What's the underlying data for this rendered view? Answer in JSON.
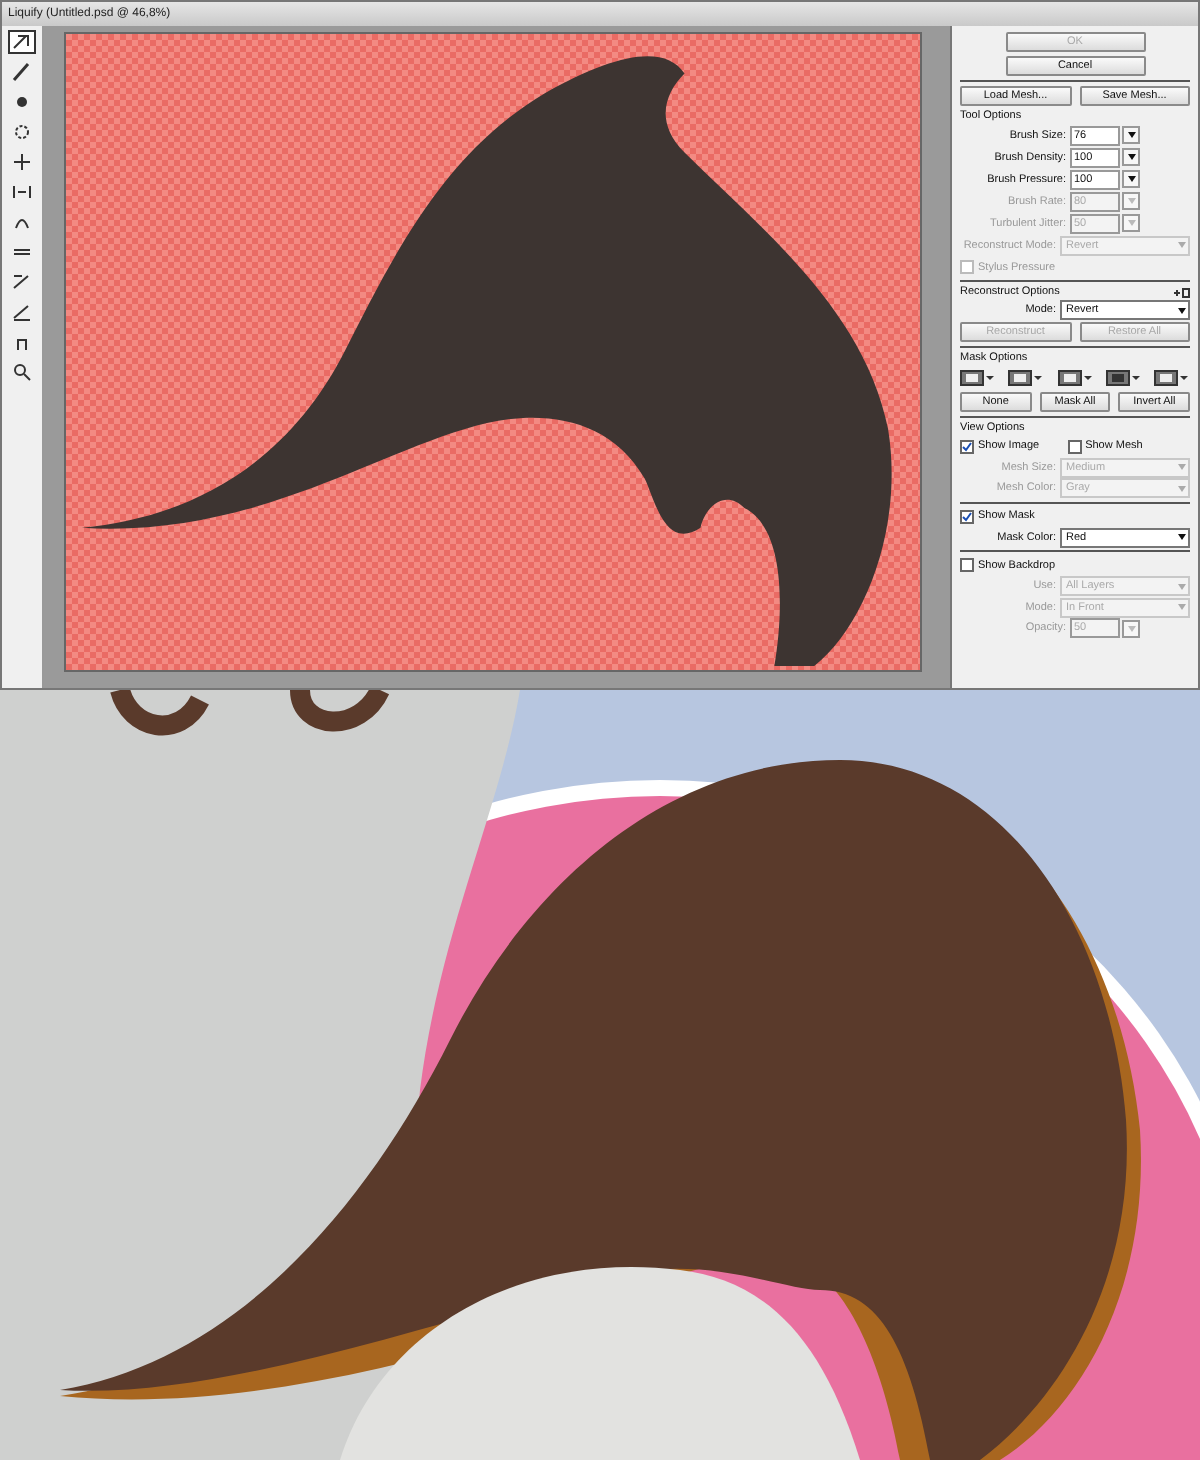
{
  "window": {
    "title": "Liquify (Untitled.psd @ 46,8%)"
  },
  "toolbar": {
    "tools": [
      {
        "selected": true
      },
      {
        "selected": false
      },
      {
        "selected": false
      },
      {
        "selected": false
      },
      {
        "selected": false
      },
      {
        "selected": false
      },
      {
        "selected": false
      },
      {
        "selected": false
      },
      {
        "selected": false
      },
      {
        "selected": false
      },
      {
        "selected": false
      },
      {
        "selected": false
      }
    ]
  },
  "panel": {
    "top_buttons": [
      {
        "label": "OK",
        "disabled": true
      },
      {
        "label": "Cancel",
        "disabled": false
      }
    ],
    "mesh_buttons": [
      {
        "label": "Load Mesh...",
        "disabled": false
      },
      {
        "label": "Save Mesh...",
        "disabled": false
      }
    ],
    "sections": [
      {
        "heading": "Tool Options",
        "rows": [
          {
            "kind": "number",
            "label": "Brush Size:",
            "value": "76",
            "disabled": false
          },
          {
            "kind": "number",
            "label": "Brush Density:",
            "value": "100",
            "disabled": false
          },
          {
            "kind": "number",
            "label": "Brush Pressure:",
            "value": "100",
            "disabled": false
          },
          {
            "kind": "number",
            "label": "Brush Rate:",
            "value": "80",
            "disabled": true
          },
          {
            "kind": "number",
            "label": "Turbulent Jitter:",
            "value": "50",
            "disabled": true
          },
          {
            "kind": "select",
            "label": "Reconstruct Mode:",
            "value": "Revert",
            "disabled": true
          },
          {
            "kind": "checkbox",
            "items": [
              {
                "label": "Stylus Pressure",
                "checked": false,
                "disabled": true
              }
            ]
          }
        ]
      },
      {
        "heading": "Reconstruct Options",
        "rows": [
          {
            "kind": "select",
            "label": "Mode:",
            "value": "Revert",
            "disabled": false
          },
          {
            "kind": "buttons",
            "buttons": [
              {
                "label": "Reconstruct",
                "disabled": true
              },
              {
                "label": "Restore All",
                "disabled": true
              }
            ]
          }
        ]
      },
      {
        "heading": "Mask Options",
        "rows": [
          {
            "kind": "mask-icons"
          },
          {
            "kind": "buttons",
            "buttons": [
              {
                "label": "None",
                "disabled": false
              },
              {
                "label": "Mask All",
                "disabled": false
              },
              {
                "label": "Invert All",
                "disabled": false
              }
            ]
          }
        ]
      },
      {
        "heading": "View Options",
        "rows": [
          {
            "kind": "checkbox",
            "items": [
              {
                "label": "Show Image",
                "checked": true,
                "disabled": false
              },
              {
                "label": "Show Mesh",
                "checked": false,
                "disabled": false
              }
            ]
          },
          {
            "kind": "select",
            "label": "Mesh Size:",
            "value": "Medium",
            "disabled": true
          },
          {
            "kind": "select",
            "label": "Mesh Color:",
            "value": "Gray",
            "disabled": true
          }
        ]
      },
      {
        "rows": [
          {
            "kind": "checkbox",
            "items": [
              {
                "label": "Show Mask",
                "checked": true,
                "disabled": false
              }
            ]
          },
          {
            "kind": "select",
            "label": "Mask Color:",
            "value": "Red",
            "disabled": false
          }
        ]
      },
      {
        "rows": [
          {
            "kind": "checkbox",
            "items": [
              {
                "label": "Show Backdrop",
                "checked": false,
                "disabled": false
              }
            ]
          },
          {
            "kind": "select",
            "label": "Use:",
            "value": "All Layers",
            "disabled": true
          },
          {
            "kind": "select",
            "label": "Mode:",
            "value": "In Front",
            "disabled": true
          },
          {
            "kind": "number",
            "label": "Opacity:",
            "value": "50",
            "disabled": true
          }
        ]
      }
    ]
  }
}
